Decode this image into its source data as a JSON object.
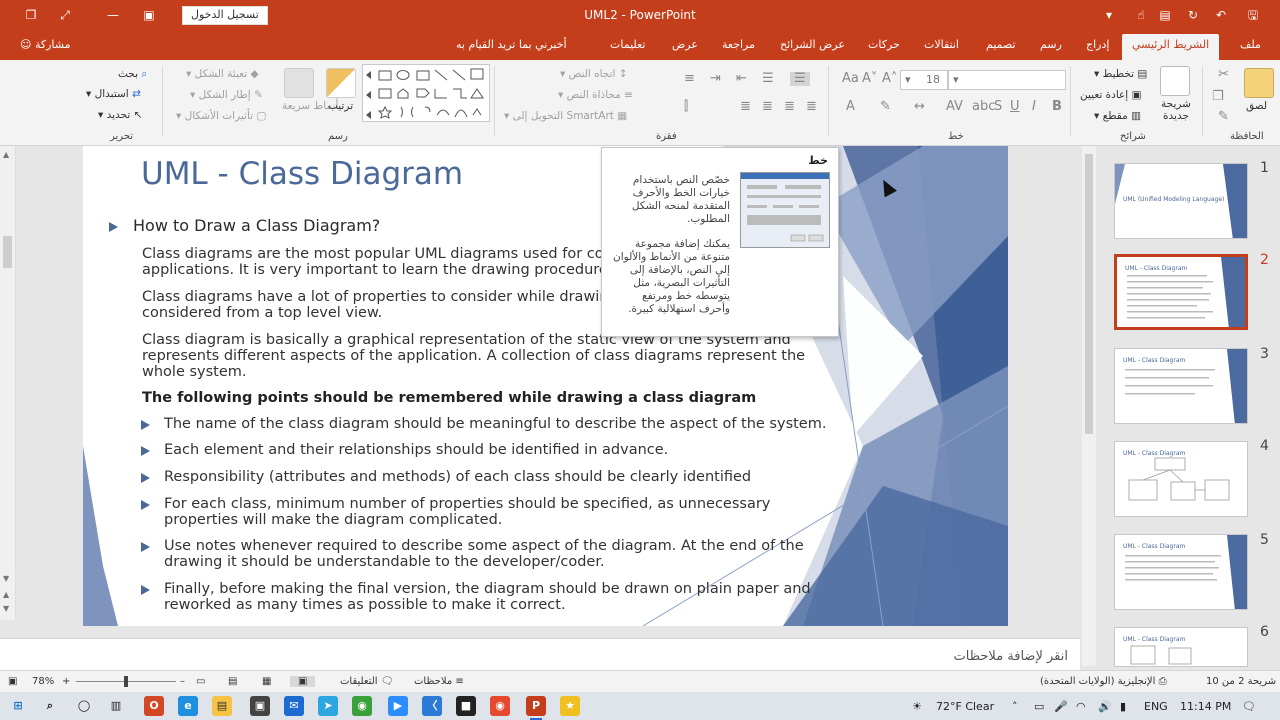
{
  "titlebar": {
    "title": "UML2  -  PowerPoint",
    "signin_label": "تسجيل الدخول"
  },
  "tabs": [
    {
      "label": "ملف"
    },
    {
      "label": "الشريط الرئيسي",
      "active": true
    },
    {
      "label": "إدراج"
    },
    {
      "label": "رسم"
    },
    {
      "label": "تصميم"
    },
    {
      "label": "انتقالات"
    },
    {
      "label": "حركات"
    },
    {
      "label": "عرض الشرائح"
    },
    {
      "label": "مراجعة"
    },
    {
      "label": "عرض"
    },
    {
      "label": "تعليمات"
    },
    {
      "label": "أخبرني بما تريد القيام به"
    }
  ],
  "share_label": "مشاركة",
  "ribbon": {
    "groups": {
      "clipboard": "الحافظة",
      "slides": "شرائح",
      "font": "خط",
      "paragraph": "فقرة",
      "drawing": "رسم",
      "editing": "تحرير"
    },
    "clipboard": {
      "paste": "لصق"
    },
    "slides": {
      "new_slide": "شريحة جديدة",
      "layout": "تخطيط",
      "reset": "إعادة تعيين",
      "section": "مقطع"
    },
    "font": {
      "size": "18",
      "bold": "B",
      "italic": "I",
      "underline": "U",
      "shadow": "S"
    },
    "paragraph": {
      "text_direction": "اتجاه النص",
      "align_text": "محاذاة النص",
      "smartart": "التحويل إلى SmartArt"
    },
    "drawing": {
      "arrange": "ترتيب",
      "quick_styles": "أنماط سريعة",
      "shape_fill": "تعبئة الشكل",
      "shape_outline": "إطار الشكل",
      "shape_effects": "تأثيرات الأشكال"
    },
    "editing": {
      "find": "بحث",
      "replace": "استبدال",
      "select": "تحديد"
    }
  },
  "slide": {
    "title": "UML - Class Diagram",
    "heading": "How to Draw a Class Diagram?",
    "paragraphs": [
      "Class diagrams are the most popular UML diagrams used for constr",
      "applications. It is very important to learn the drawing procedure c",
      "Class diagrams have a lot of properties to consider while drawing",
      "considered from a top level view.",
      "Class diagram is basically a graphical representation of the static view of the system and",
      "represents different aspects of the application. A collection of class diagrams represent the",
      "whole system."
    ],
    "bold_line": "The following points should be remembered while drawing a class diagram",
    "bullets": [
      [
        "The name of the class diagram should be meaningful to describe the aspect of the system."
      ],
      [
        "Each element and their relationships should be identified in advance."
      ],
      [
        "Responsibility (attributes and methods) of each class should be clearly identified"
      ],
      [
        "For each class, minimum number of properties should be specified, as unnecessary",
        "properties will make the diagram complicated."
      ],
      [
        "Use notes whenever required to describe some aspect of the diagram. At the end of the",
        "drawing it should be understandable to the developer/coder."
      ],
      [
        "Finally, before making the final version, the diagram should be drawn on plain paper and",
        "reworked as many times as possible to make it correct."
      ]
    ]
  },
  "tooltip": {
    "title": "خط",
    "text1": "خصّص النص باستخدام خيارات الخط والأحرف المتقدمة لمنحه الشكل المطلوب.",
    "text2": "يمكنك إضافة مجموعة متنوعة من الأنماط والألوان إلى النص، بالإضافة إلى التأثيرات البصرية، مثل يتوسطه خط ومرتفع وأحرف استهلالية كبيرة."
  },
  "thumbnails": [
    {
      "num": "1",
      "title": "UML (Unified Modeling Language)"
    },
    {
      "num": "2",
      "title": "UML - Class Diagram",
      "selected": true
    },
    {
      "num": "3",
      "title": "UML - Class Diagram"
    },
    {
      "num": "4",
      "title": "UML - Class Diagram"
    },
    {
      "num": "5",
      "title": "UML - Class Diagram"
    },
    {
      "num": "6",
      "title": "UML - Class Diagram"
    }
  ],
  "notes_placeholder": "انقر لإضافة ملاحظات",
  "statusbar": {
    "slide_count": "شريحة 2 من 10",
    "language": "الإنجليزية (الولايات المتحدة)",
    "notes": "ملاحظات",
    "comments": "التعليقات",
    "zoom": "78%",
    "zoom_fraction": 0.5
  },
  "taskbar": {
    "weather": "72°F  Clear",
    "lang": "ENG",
    "time": "11:14 PM"
  },
  "colors": {
    "accent": "#c43e1c",
    "slide_title": "#4a6898"
  }
}
